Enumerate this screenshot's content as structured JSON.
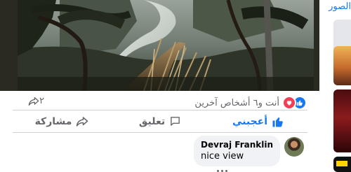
{
  "post": {
    "reactions": {
      "summary": "أنت و٦ أشخاص آخرين",
      "types": [
        "like",
        "love"
      ]
    },
    "shares_count": "٢",
    "actions": {
      "like_label": "أعجبني",
      "comment_label": "تعليق",
      "share_label": "مشاركة"
    },
    "comments": [
      {
        "author": "Devraj Franklin",
        "text": "nice view"
      }
    ]
  },
  "sidebar": {
    "title": "الصور"
  },
  "colors": {
    "accent": "#1877f2",
    "love": "#f33e58",
    "muted_text": "#65676b",
    "bubble": "#f0f2f5"
  },
  "icons": [
    "photo",
    "like-icon",
    "love-icon",
    "share-icon",
    "comment-icon",
    "thumbs-up-icon",
    "avatar"
  ]
}
